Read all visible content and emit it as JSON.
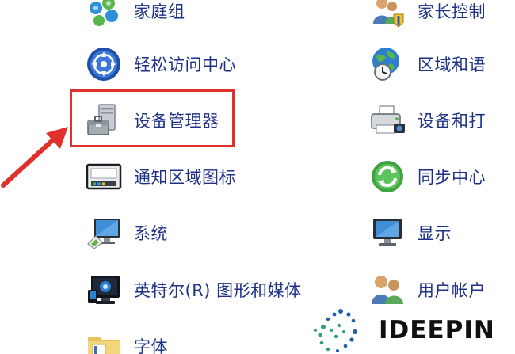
{
  "left_items": [
    {
      "label": "家庭组",
      "icon": "homegroup-icon"
    },
    {
      "label": "轻松访问中心",
      "icon": "ease-of-access-icon"
    },
    {
      "label": "设备管理器",
      "icon": "device-manager-icon"
    },
    {
      "label": "通知区域图标",
      "icon": "notification-area-icon"
    },
    {
      "label": "系统",
      "icon": "system-icon"
    },
    {
      "label": "英特尔(R) 图形和媒体",
      "icon": "intel-graphics-icon"
    },
    {
      "label": "字体",
      "icon": "fonts-folder-icon"
    }
  ],
  "right_items": [
    {
      "label": "家长控制",
      "icon": "parental-controls-icon"
    },
    {
      "label": "区域和语",
      "icon": "region-language-icon"
    },
    {
      "label": "设备和打",
      "icon": "devices-printers-icon"
    },
    {
      "label": "同步中心",
      "icon": "sync-center-icon"
    },
    {
      "label": "显示",
      "icon": "display-icon"
    },
    {
      "label": "用户帐户",
      "icon": "user-accounts-icon"
    }
  ],
  "highlight": {
    "target": "设备管理器",
    "color": "#e0302c"
  },
  "watermark": {
    "text": "IDEEPIN"
  },
  "colors": {
    "link_text": "#1e3287",
    "highlight": "#e0302c",
    "arrow": "#e0302c"
  }
}
